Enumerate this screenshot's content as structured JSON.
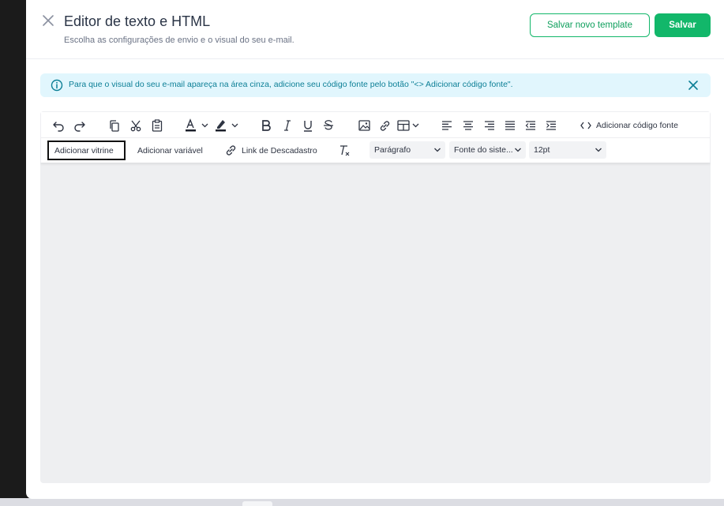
{
  "header": {
    "title": "Editor de texto e HTML",
    "subtitle": "Escolha as configurações de envio e o visual do seu e-mail.",
    "save_template_label": "Salvar novo template",
    "save_label": "Salvar"
  },
  "info_banner": {
    "text": "Para que o visual do seu e-mail apareça na área cinza, adicione seu código fonte pelo botão \"<> Adicionar código fonte\"."
  },
  "toolbar": {
    "add_source_code_label": "Adicionar código fonte",
    "add_showcase_label": "Adicionar vitrine",
    "add_variable_label": "Adicionar variável",
    "unsubscribe_link_label": "Link de Descadastro",
    "block_format_value": "Parágrafo",
    "font_family_value": "Fonte do siste...",
    "font_size_value": "12pt"
  },
  "colors": {
    "accent": "#12b76a",
    "info_bg": "#e1f6fd",
    "info_text": "#0c7f96",
    "editor_bg": "#eeeff1"
  },
  "icons": [
    "close-icon",
    "info-icon",
    "undo-icon",
    "redo-icon",
    "copy-icon",
    "cut-icon",
    "paste-icon",
    "text-color-icon",
    "highlight-color-icon",
    "bold-icon",
    "italic-icon",
    "underline-icon",
    "strikethrough-icon",
    "image-icon",
    "link-icon",
    "table-icon",
    "align-left-icon",
    "align-center-icon",
    "align-right-icon",
    "align-justify-icon",
    "outdent-icon",
    "indent-icon",
    "code-icon",
    "clear-format-icon",
    "chevron-down-icon"
  ]
}
